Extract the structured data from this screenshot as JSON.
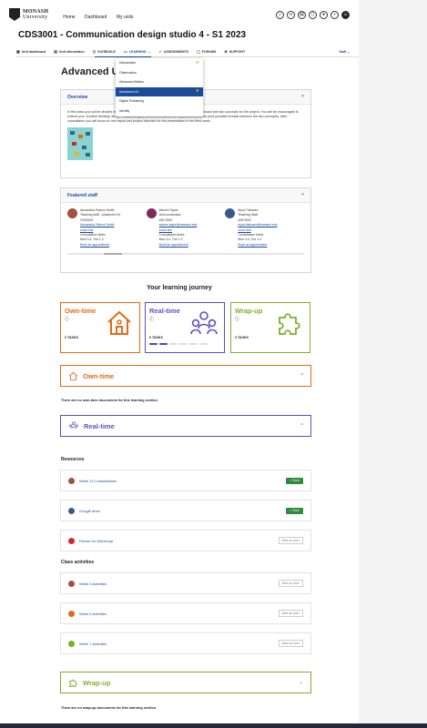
{
  "header": {
    "logo_line1": "MONASH",
    "logo_line2": "University",
    "nav": [
      "Home",
      "Dashboard",
      "My units"
    ],
    "icons": [
      "search-icon",
      "link-icon",
      "book-icon",
      "device-icon",
      "bell-icon",
      "chat-icon",
      "user-icon"
    ]
  },
  "unit": {
    "title": "CDS3001 - Communication design studio 4 - S1 2023"
  },
  "tabs": {
    "items": [
      {
        "label": "Unit dashboard",
        "icon": "dashboard-icon"
      },
      {
        "label": "Unit information",
        "icon": "info-icon"
      },
      {
        "label": "SCHEDULE",
        "icon": "clock-icon"
      },
      {
        "label": "LEARNING",
        "icon": "learning-icon"
      },
      {
        "label": "ASSESSMENTS",
        "icon": "check-icon"
      },
      {
        "label": "FORUMS",
        "icon": "forum-icon"
      },
      {
        "label": "SUPPORT",
        "icon": "support-icon"
      }
    ],
    "right": "Staff"
  },
  "dropdown": {
    "items": [
      "Introduction",
      "Observation",
      "Advanced Motion",
      "Advanced UX",
      "Digital Publishing",
      "Identity"
    ],
    "selected": "Advanced UX"
  },
  "page_title": "Advanced UX",
  "overview": {
    "heading": "Overview",
    "text": "In this class you will be divided into pairs, after which you will work together to build a concept board and two concepts for the project. You will be encouraged to extend your 'creative thinking' ability - establishing connections between the keywords and ideas (and possible threads between the two concepts). After consultation you will focus on one layout and project direction for the presentation in the third week."
  },
  "staff": {
    "heading": "Featured staff",
    "people": [
      {
        "name": "Alexandria Patroni-Smith",
        "role": "Teaching staff - Advanced UX",
        "code": "CDS3001",
        "email": "Alexandria Patroni-Smith",
        "zoom": "zoom link",
        "times_label": "Consultation times",
        "times": "Mon 3-4, Tue 1-2",
        "book": "Book an appointment",
        "color": "#a0523d"
      },
      {
        "name": "Warren Taylor",
        "role": "Unit coordinator",
        "code": "ARC3002",
        "email": "warren.taylor@monash.edu",
        "zoom": "zoom link",
        "times_label": "Consultation times",
        "times": "Mon 3-4, Tue 1-2",
        "book": "Book an appointment",
        "color": "#7a2c5a"
      },
      {
        "name": "Myra Thiessen",
        "role": "Teaching Staff",
        "code": "ARC3002",
        "email": "myra.thiessen@monash.edu",
        "zoom": "zoom link",
        "times_label": "Consultation times",
        "times": "Mon 3-4, Tue 1-2",
        "book": "Book an appointment",
        "color": "#3a5a8c"
      }
    ]
  },
  "journey": {
    "title": "Your learning journey",
    "cards": [
      {
        "name": "Own-time",
        "tasks": "0 TASKS",
        "color": "#e36a17"
      },
      {
        "name": "Real-time",
        "tasks": "6 TASKS",
        "color": "#5b4fc4",
        "progress": 0.25
      },
      {
        "name": "Wrap-up",
        "tasks": "0 TASKS",
        "color": "#7caf2b"
      }
    ]
  },
  "owntime": {
    "label": "Own-time",
    "note": "There are no own-time documents for this learning section"
  },
  "realtime": {
    "label": "Real-time"
  },
  "resources": {
    "heading": "Resources",
    "items": [
      {
        "label": "Week 13 Consultations",
        "status": "✓ Done",
        "icon": "consultation-icon",
        "color": "#a0523d"
      },
      {
        "label": "Google drive",
        "status": "✓ Done",
        "icon": "drive-icon",
        "color": "#3a5a8c"
      },
      {
        "label": "Picture for Workshop",
        "status": "Mark as done",
        "icon": "picture-icon",
        "color": "#d9262a"
      }
    ]
  },
  "activities": {
    "heading": "Class activities",
    "items": [
      {
        "label": "Week 3 Activities",
        "status": "Mark as done",
        "color": "#a0523d"
      },
      {
        "label": "Week 5 Activities",
        "status": "Mark as done",
        "color": "#e36a17"
      },
      {
        "label": "Week 7 Activities",
        "status": "Mark as done",
        "color": "#7caf2b"
      }
    ]
  },
  "wrapup": {
    "label": "Wrap-up",
    "note": "There are no wrap-up documents for this learning section"
  }
}
